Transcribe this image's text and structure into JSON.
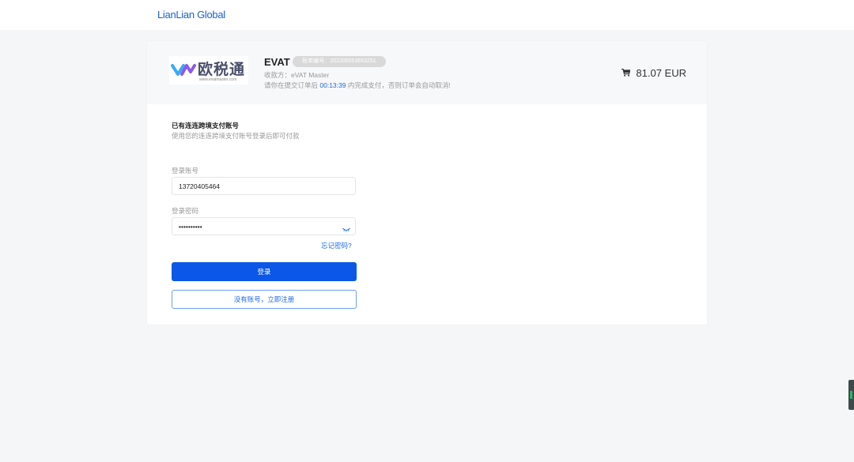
{
  "topbar": {
    "brand": "LianLian Global"
  },
  "order": {
    "logo_text": "欧税通",
    "logo_url": "www.evatmaster.com",
    "merchant": "EVAT",
    "bill_label": "账单编号：",
    "bill_number": "202205053653251",
    "payee_label": "收款方：",
    "payee": "eVAT Master",
    "deadline_prefix": "请你在提交订单后",
    "deadline_time": "00:13:39",
    "deadline_suffix": "内完成支付，否则订单会自动取消!",
    "cart_icon": "cart-icon",
    "total": "81.07 EUR"
  },
  "login": {
    "title": "已有连连跨境支付账号",
    "subtitle": "使用您的连连跨境支付账号登录后即可付款",
    "account_label": "登录账号",
    "account_value": "13720405464",
    "password_label": "登录密码",
    "password_value": "••••••••••",
    "eye_icon": "eye-closed-icon",
    "forgot": "忘记密码?",
    "login_button": "登录",
    "register_button": "没有账号，立即注册"
  },
  "colors": {
    "primary": "#0a57e8",
    "link": "#1f6ae6",
    "brand": "#1a5fd6"
  }
}
